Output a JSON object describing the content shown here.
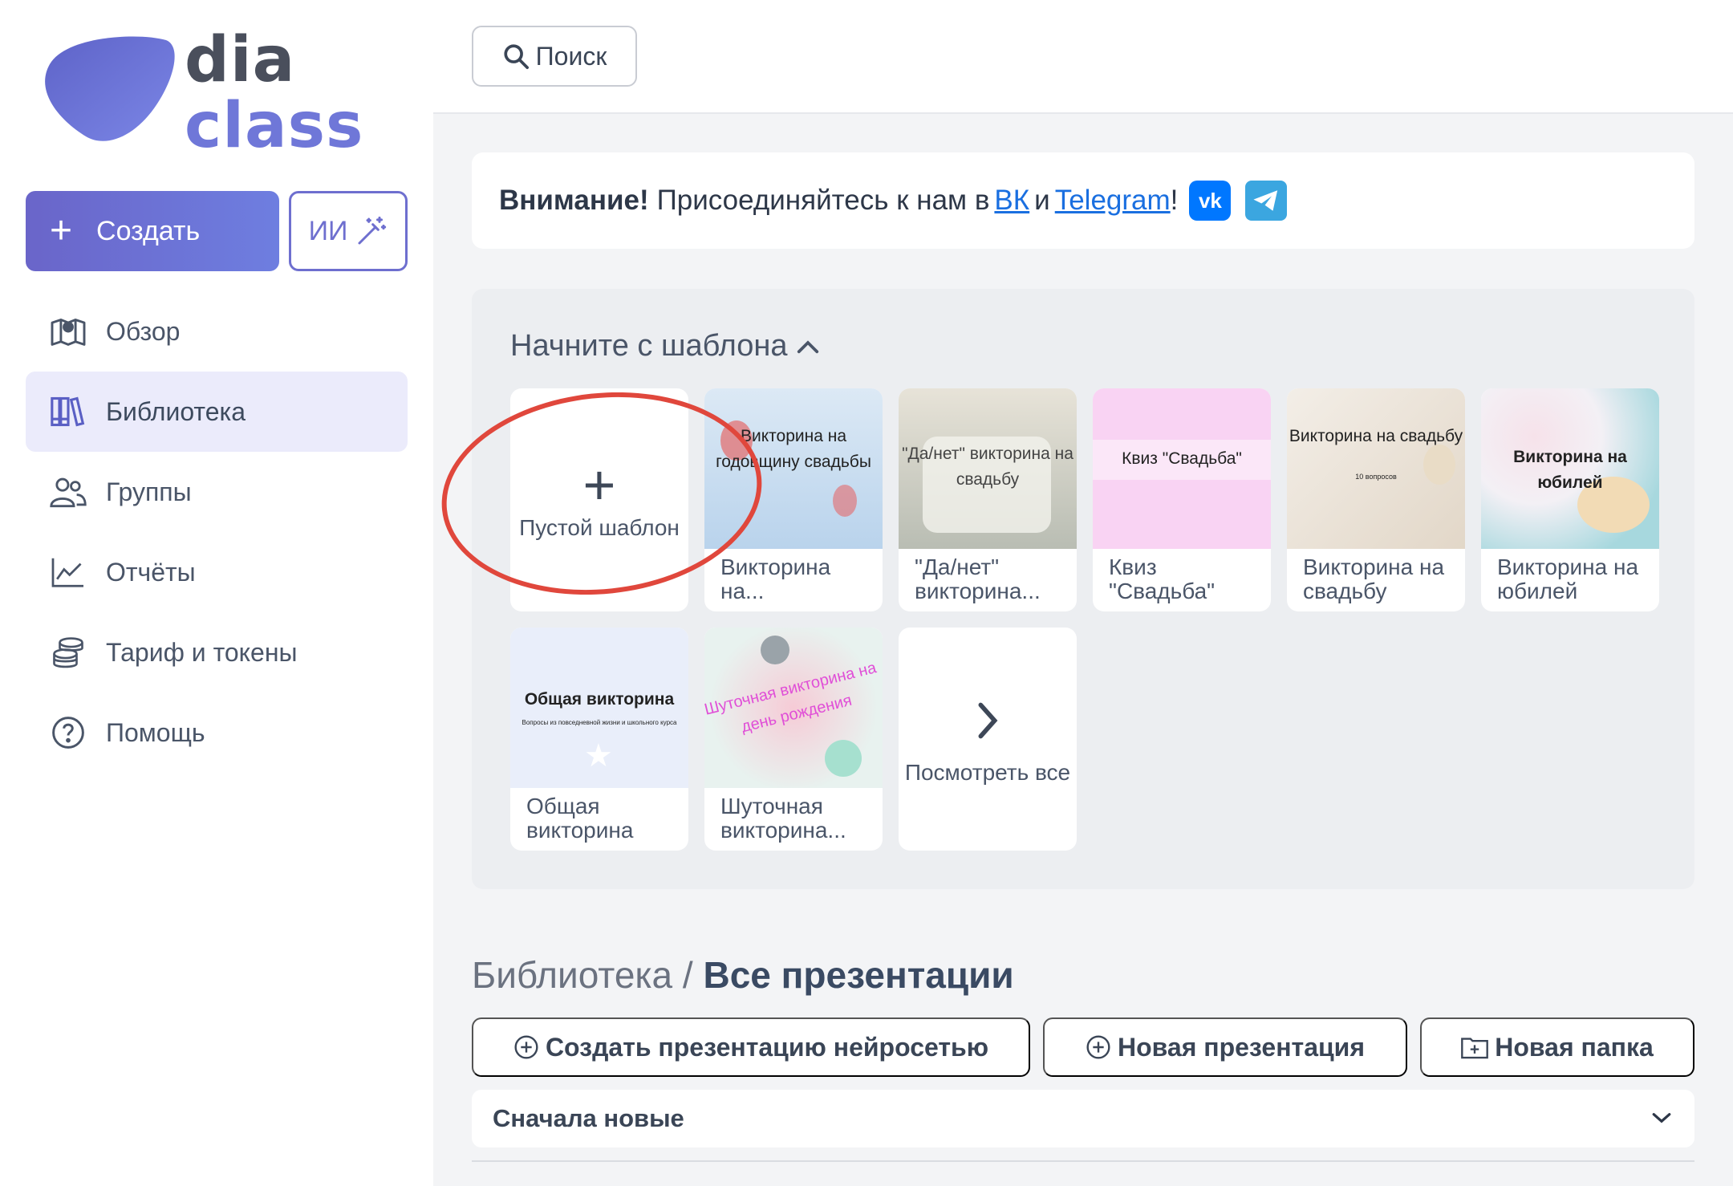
{
  "logo": {
    "line1": "dia",
    "line2": "class"
  },
  "sidebar": {
    "create_label": "Создать",
    "ai_label": "ИИ",
    "items": [
      {
        "label": "Обзор",
        "icon": "map-icon",
        "active": false
      },
      {
        "label": "Библиотека",
        "icon": "library-icon",
        "active": true
      },
      {
        "label": "Группы",
        "icon": "users-icon",
        "active": false
      },
      {
        "label": "Отчёты",
        "icon": "chart-icon",
        "active": false
      },
      {
        "label": "Тариф и токены",
        "icon": "coins-icon",
        "active": false
      },
      {
        "label": "Помощь",
        "icon": "help-icon",
        "active": false
      }
    ]
  },
  "topbar": {
    "search_label": "Поиск"
  },
  "notice": {
    "bold": "Внимание!",
    "text": "Присоединяйтесь к нам в",
    "link1": "ВК",
    "and": "и",
    "link2": "Telegram",
    "end": "!",
    "vk_badge": "vk"
  },
  "templates": {
    "heading": "Начните с шаблона",
    "empty_label": "Пустой шаблон",
    "view_all": "Посмотреть все",
    "cards": [
      {
        "thumb_text": "Викторина на годовщину свадьбы",
        "caption": "Викторина на..."
      },
      {
        "thumb_text": "\"Да/нет\" викторина на свадьбу",
        "caption": "\"Да/нет\" викторина..."
      },
      {
        "thumb_text": "Квиз \"Свадьба\"",
        "caption": "Квиз \"Свадьба\""
      },
      {
        "thumb_text": "Викторина на свадьбу",
        "thumb_sub": "10 вопросов",
        "caption": "Викторина на свадьбу"
      },
      {
        "thumb_text": "Викторина на юбилей",
        "caption": "Викторина на юбилей"
      },
      {
        "thumb_text": "Общая викторина",
        "thumb_sub": "Вопросы из повседневной жизни и школьного курса",
        "caption": "Общая викторина"
      },
      {
        "thumb_text": "Шуточная викторина на день рождения",
        "caption": "Шуточная викторина..."
      }
    ]
  },
  "library": {
    "crumb": "Библиотека /",
    "title": "Все презентации",
    "btn_ai": "Создать презентацию нейросетью",
    "btn_new": "Новая презентация",
    "btn_folder": "Новая папка",
    "sort_label": "Сначала новые"
  },
  "colors": {
    "accent": "#6e6fcf",
    "link": "#1a6fe0",
    "annotation": "#e0473c"
  }
}
